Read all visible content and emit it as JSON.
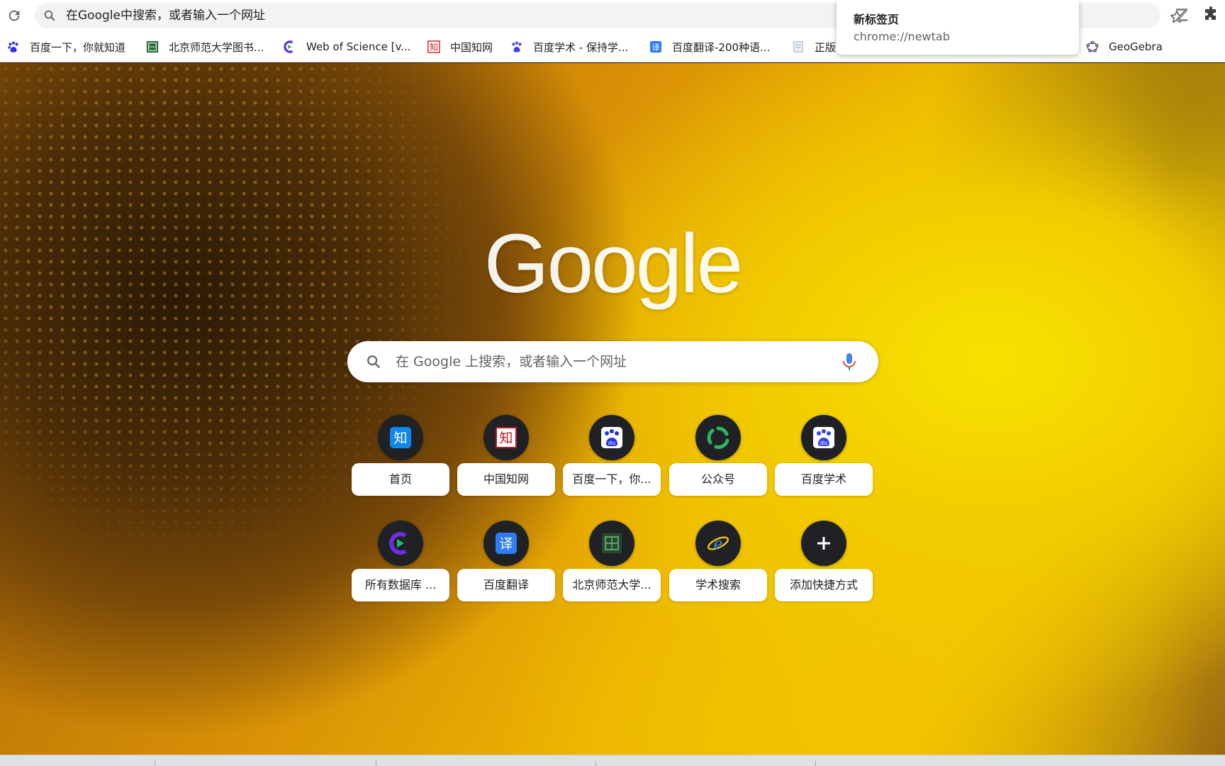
{
  "toolbar": {
    "omnibox_placeholder": "在Google中搜索，或者输入一个网址",
    "icons": [
      "reload-icon",
      "search-icon",
      "bookmark-star-icon",
      "zotero-extension-icon",
      "extensions-puzzle-icon"
    ]
  },
  "bookmarks": [
    {
      "label": "百度一下，你就知道",
      "icon": "baidu-paw-icon"
    },
    {
      "label": "北京师范大学图书...",
      "icon": "bnu-library-icon"
    },
    {
      "label": "Web of Science [v...",
      "icon": "web-of-science-icon"
    },
    {
      "label": "中国知网",
      "icon": "cnki-icon"
    },
    {
      "label": "百度学术 - 保持学...",
      "icon": "baidu-scholar-icon"
    },
    {
      "label": "百度翻译-200种语...",
      "icon": "baidu-translate-icon"
    },
    {
      "label": "正版",
      "icon": "document-icon"
    },
    {
      "label": "GeoGebra",
      "icon": "geogebra-icon"
    }
  ],
  "tab_hover_card": {
    "title": "新标签页",
    "url": "chrome://newtab"
  },
  "ntp": {
    "logo": "Google",
    "search_placeholder": "在 Google 上搜索，或者输入一个网址",
    "shortcuts": [
      {
        "label": "首页",
        "icon": "zhihu-icon"
      },
      {
        "label": "中国知网",
        "icon": "cnki-icon"
      },
      {
        "label": "百度一下，你...",
        "icon": "baidu-paw-icon"
      },
      {
        "label": "公众号",
        "icon": "wechat-public-icon"
      },
      {
        "label": "百度学术",
        "icon": "baidu-scholar-icon"
      },
      {
        "label": "所有数据库 ...",
        "icon": "web-of-science-icon"
      },
      {
        "label": "百度翻译",
        "icon": "baidu-translate-icon"
      },
      {
        "label": "北京师范大学...",
        "icon": "bnu-library-icon"
      },
      {
        "label": "学术搜索",
        "icon": "ie-icon"
      },
      {
        "label": "添加快捷方式",
        "icon": "plus-icon"
      }
    ]
  },
  "colors": {
    "baidu_blue": "#2932e1",
    "zhihu_blue": "#0f88eb",
    "cnki_red": "#c8161d",
    "wechat_green": "#07c160",
    "mic_blue": "#4285f4"
  }
}
